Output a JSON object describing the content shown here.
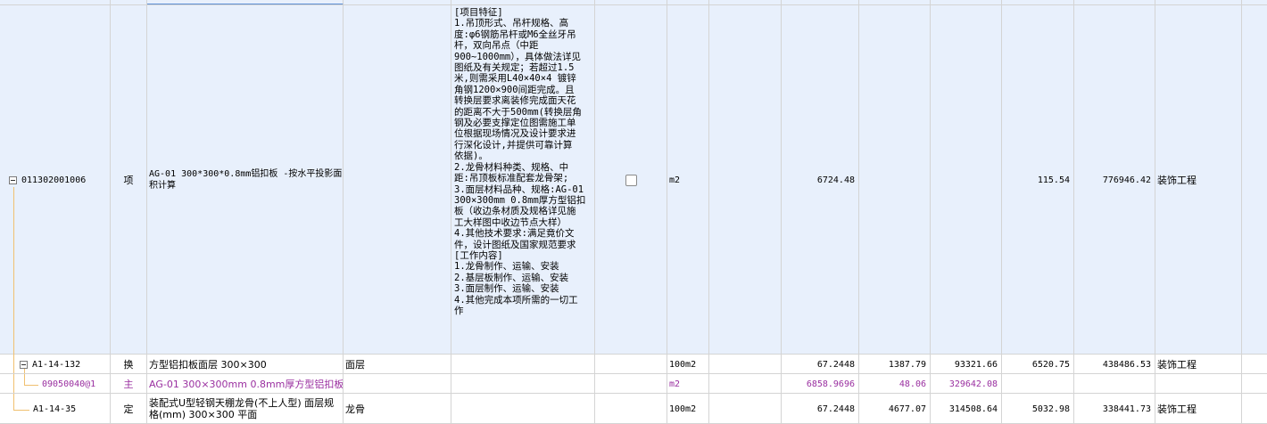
{
  "rows": [
    {
      "code": "011302001006",
      "type": "项",
      "name": "AG-01 300*300*0.8mm铝扣板 -按水平投影面积计算",
      "spec": "",
      "features": "[项目特征]\n1.吊顶形式、吊杆规格、高\n度:φ6钢筋吊杆或M6全丝牙吊\n杆，双向吊点（中距\n900~1000mm），具体做法详见\n图纸及有关规定；若超过1.5\n米,则需采用L40×40×4 镀锌\n角钢1200×900间距完成。且\n转换层要求离装修完成面天花\n的距离不大于500mm(转换层角\n钢及必要支撑定位图需施工单\n位根据现场情况及设计要求进\n行深化设计,并提供可靠计算\n依据)。\n2.龙骨材料种类、规格、中\n距:吊顶板标准配套龙骨架;\n3.面层材料品种、规格:AG-01\n300×300mm 0.8mm厚方型铝扣\n板（收边条材质及规格详见施\n工大样图中收边节点大样）\n4.其他技术要求:满足竟价文\n件，设计图纸及国家规范要求\n[工作内容]\n1.龙骨制作、运输、安装\n2.基层板制作、运输、安装\n3.面层制作、运输、安装\n4.其他完成本项所需的一切工\n作",
      "unit": "m2",
      "quantity": "6724.48",
      "price": "",
      "total": "",
      "unit_price2": "115.54",
      "total2": "776946.42",
      "category": "装饰工程"
    },
    {
      "code": "A1-14-132",
      "type": "换",
      "name": "方型铝扣板面层 300×300",
      "spec": "面层",
      "unit": "100m2",
      "quantity": "67.2448",
      "price": "1387.79",
      "total": "93321.66",
      "unit_price2": "6520.75",
      "total2": "438486.53",
      "category": "装饰工程"
    },
    {
      "code": "09050040@1",
      "type": "主",
      "name": "AG-01 300×300mm 0.8mm厚方型铝扣板",
      "spec": "",
      "unit": "m2",
      "quantity": "6858.9696",
      "price": "48.06",
      "total": "329642.08",
      "unit_price2": "",
      "total2": "",
      "category": ""
    },
    {
      "code": "A1-14-35",
      "type": "定",
      "name": "装配式U型轻钢天棚龙骨(不上人型) 面层规格(mm) 300×300 平面",
      "spec": "龙骨",
      "unit": "100m2",
      "quantity": "67.2448",
      "price": "4677.07",
      "total": "314508.64",
      "unit_price2": "5032.98",
      "total2": "338441.73",
      "category": "装饰工程"
    }
  ],
  "colors": {
    "selected_bg": "#e8f0fc",
    "material_text": "#9a2fa0",
    "grid": "#d4d4d4"
  }
}
